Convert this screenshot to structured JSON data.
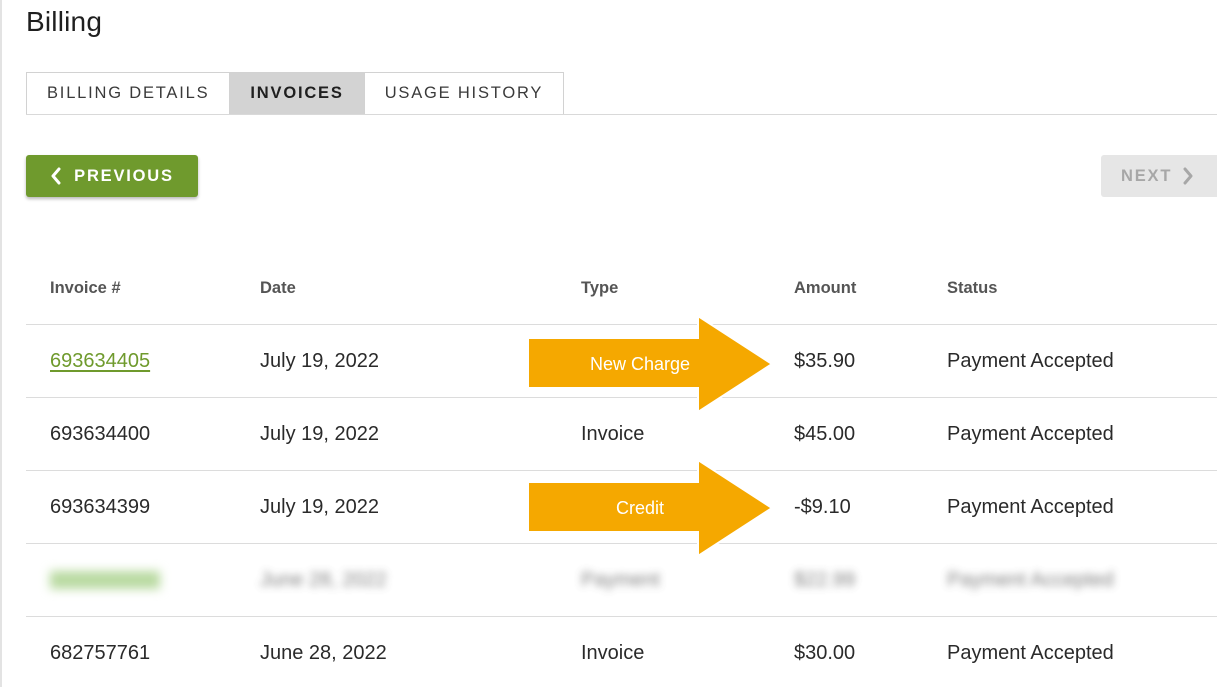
{
  "page": {
    "title": "Billing"
  },
  "tabs": [
    {
      "label": "BILLING DETAILS",
      "active": false
    },
    {
      "label": "INVOICES",
      "active": true
    },
    {
      "label": "USAGE HISTORY",
      "active": false
    }
  ],
  "pagination": {
    "previous_label": "PREVIOUS",
    "next_label": "NEXT",
    "next_disabled": true
  },
  "table": {
    "headers": [
      "Invoice #",
      "Date",
      "Type",
      "Amount",
      "Status"
    ],
    "rows": [
      {
        "invoice": "693634405",
        "date": "July 19, 2022",
        "type": "",
        "amount": "$35.90",
        "status": "Payment Accepted",
        "linked": true
      },
      {
        "invoice": "693634400",
        "date": "July 19, 2022",
        "type": "Invoice",
        "amount": "$45.00",
        "status": "Payment Accepted"
      },
      {
        "invoice": "693634399",
        "date": "July 19, 2022",
        "type": "",
        "amount": "-$9.10",
        "status": "Payment Accepted"
      },
      {
        "invoice": "",
        "date": "June 28, 2022",
        "type": "Payment",
        "amount": "$22.99",
        "status": "Payment Accepted",
        "redacted": true
      },
      {
        "invoice": "682757761",
        "date": "June 28, 2022",
        "type": "Invoice",
        "amount": "$30.00",
        "status": "Payment Accepted"
      }
    ]
  },
  "annotations": [
    {
      "label": "New Charge",
      "color": "#f5a800"
    },
    {
      "label": "Credit",
      "color": "#f5a800"
    }
  ],
  "colors": {
    "accent": "#6f9a2d",
    "annotation": "#f5a800",
    "disabled": "#e6e6e6"
  }
}
